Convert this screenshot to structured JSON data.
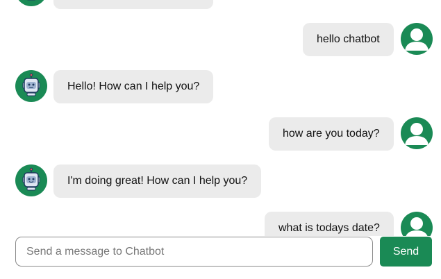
{
  "chat": {
    "messages": [
      {
        "sender": "bot",
        "text": ""
      },
      {
        "sender": "user",
        "text": "hello chatbot"
      },
      {
        "sender": "bot",
        "text": "Hello! How can I help you?"
      },
      {
        "sender": "user",
        "text": "how are you today?"
      },
      {
        "sender": "bot",
        "text": "I'm doing great! How can I help you?"
      },
      {
        "sender": "user",
        "text": "what is todays date?"
      }
    ]
  },
  "input": {
    "placeholder": "Send a message to Chatbot",
    "value": ""
  },
  "send_label": "Send",
  "colors": {
    "accent": "#1a8a55",
    "bubble": "#ebebeb",
    "robot_face": "#dfe6f2",
    "robot_outline": "#1f3a5f"
  },
  "icons": {
    "bot": "robot-icon",
    "user": "user-silhouette-icon"
  }
}
